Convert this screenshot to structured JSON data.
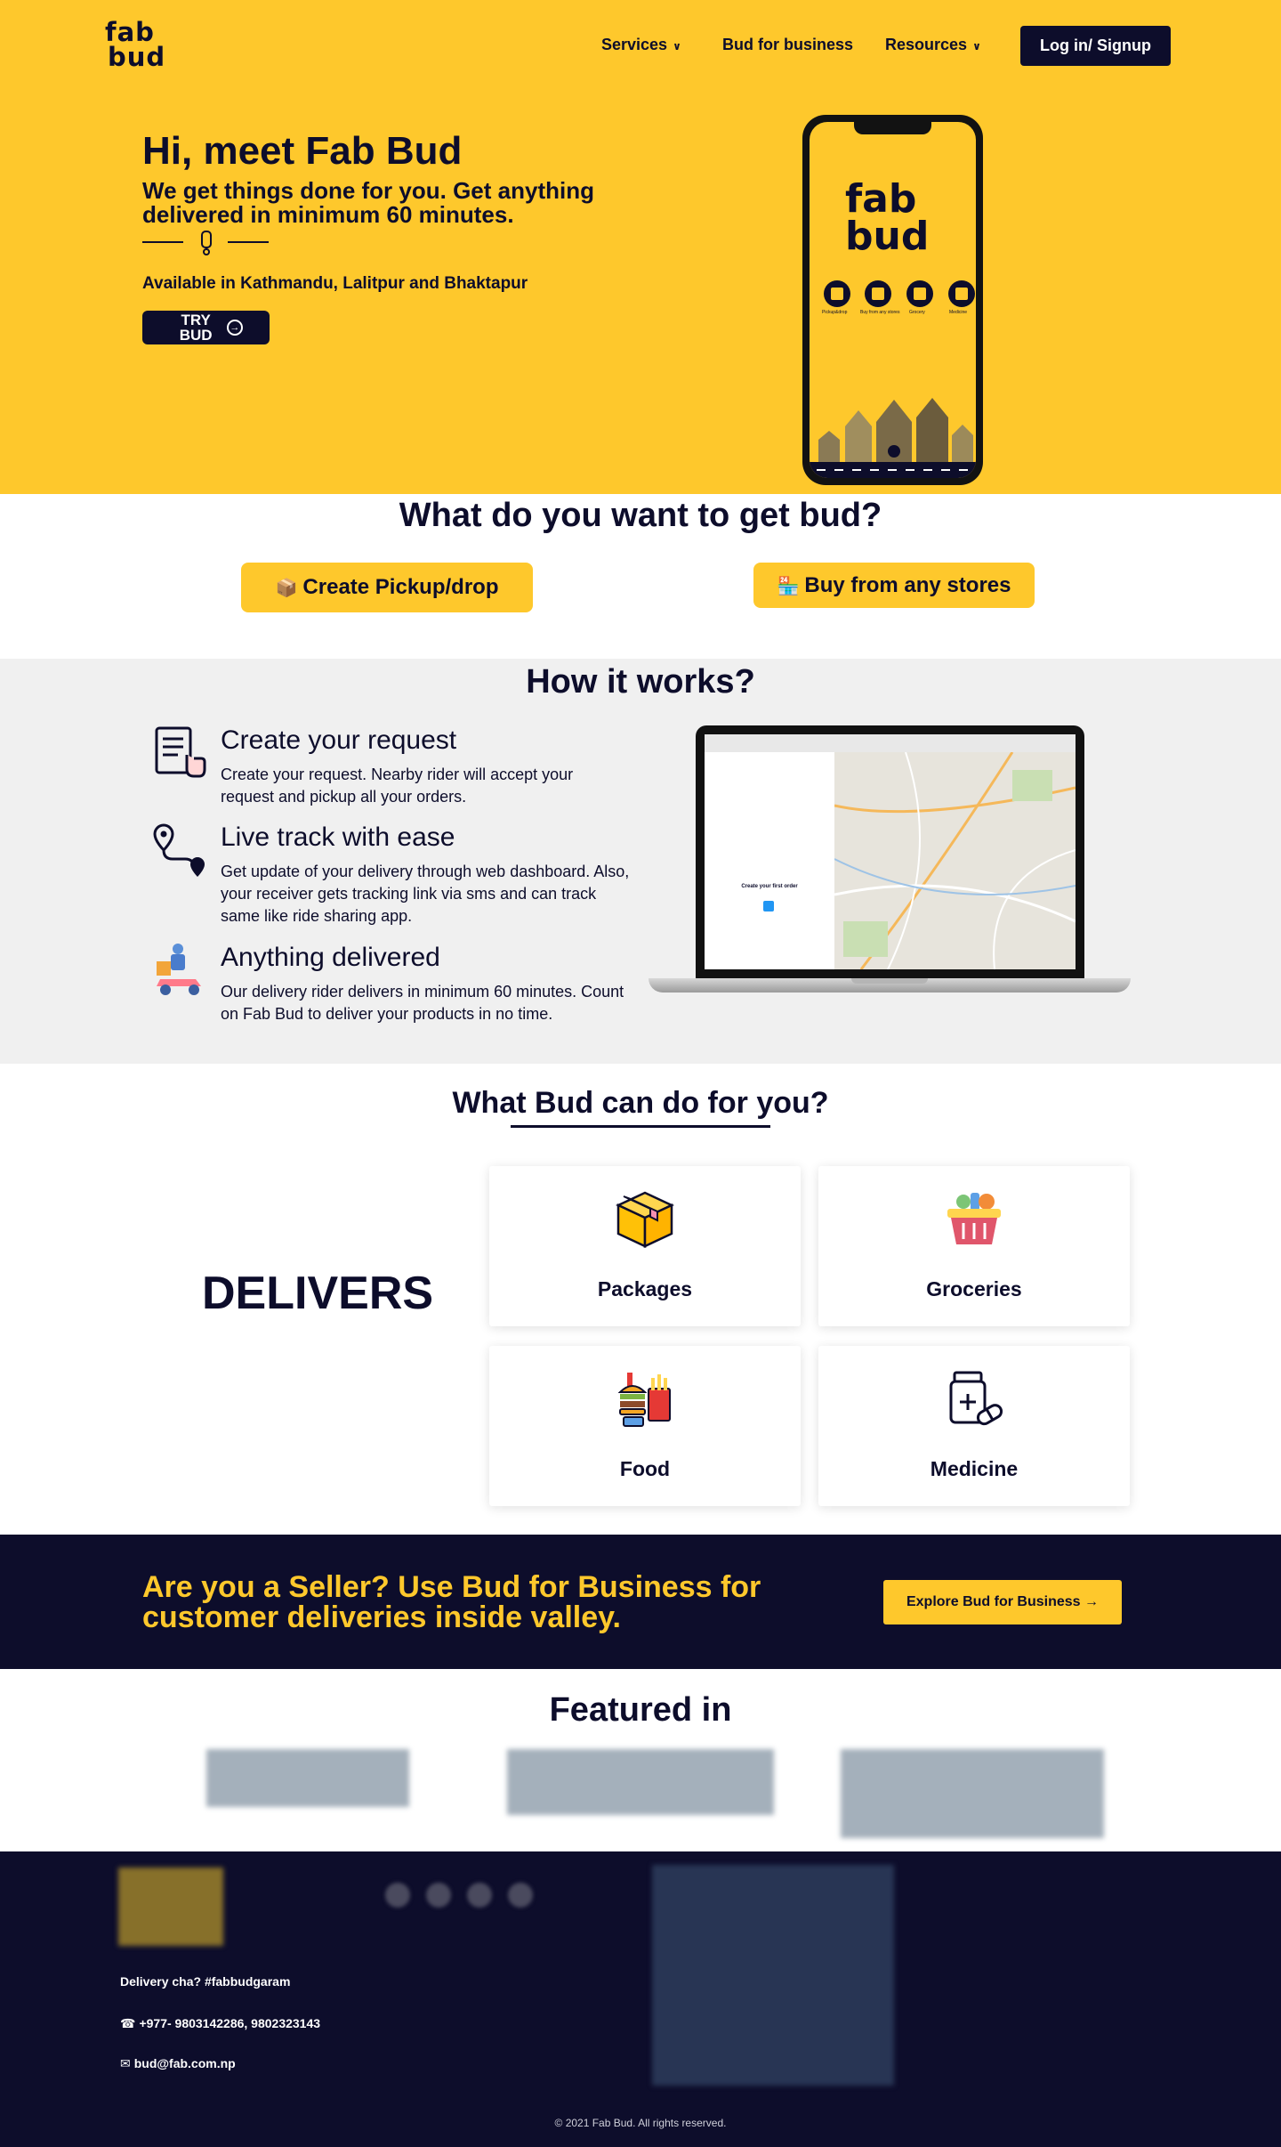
{
  "nav": {
    "logo_line1": "fab",
    "logo_line2": "bud",
    "services": "Services",
    "business": "Bud for business",
    "resources": "Resources",
    "login": "Log in/ Signup"
  },
  "hero": {
    "title": "Hi, meet Fab Bud",
    "subtitle": "We get things done for you. Get anything delivered in minimum 60 minutes.",
    "available": "Available in Kathmandu, Lalitpur and Bhaktapur",
    "try_label": "TRY BUD",
    "phone_logo_line1": "fab",
    "phone_logo_line2": "bud",
    "phone_icons": [
      "Pickup&drop",
      "Buy from any stores",
      "Grocery",
      "Medicine"
    ]
  },
  "want": {
    "title": "What do you want to get bud?",
    "pickup": "Create Pickup/drop",
    "buy": "Buy from any stores"
  },
  "how": {
    "title": "How it works?",
    "steps": [
      {
        "title": "Create your request",
        "text": "Create your request. Nearby rider will accept your request and pickup all your orders."
      },
      {
        "title": "Live track with ease",
        "text": "Get update of your delivery through web dashboard. Also, your receiver gets tracking link via sms and can track same like ride sharing app."
      },
      {
        "title": "Anything delivered",
        "text": "Our delivery rider delivers in minimum 60 minutes. Count on Fab Bud to deliver your products in no time."
      }
    ],
    "laptop_caption": "Create your first order"
  },
  "can": {
    "title": "What Bud can do for you?",
    "delivers": "DELIVERS",
    "cards": [
      "Packages",
      "Groceries",
      "Food",
      "Medicine"
    ]
  },
  "seller": {
    "text": "Are you a Seller? Use Bud for Business for customer deliveries inside valley.",
    "button": "Explore Bud for Business →"
  },
  "featured": {
    "title": "Featured in"
  },
  "footer": {
    "tagline": "Delivery cha? #fabbudgaram",
    "phone": "+977- 9803142286, 9802323143",
    "email": "bud@fab.com.np",
    "copyright": "© 2021 Fab Bud. All rights reserved."
  },
  "colors": {
    "brand_yellow": "#fec82c",
    "brand_navy": "#0d0d2b",
    "section_gray": "#f0f0f0"
  },
  "icons": {
    "pickup": "package-icon",
    "buy": "shop-icon",
    "step1": "request-form-icon",
    "step2": "route-pin-icon",
    "step3": "delivery-rider-icon",
    "phone": "phone-icon",
    "email": "envelope-icon"
  }
}
